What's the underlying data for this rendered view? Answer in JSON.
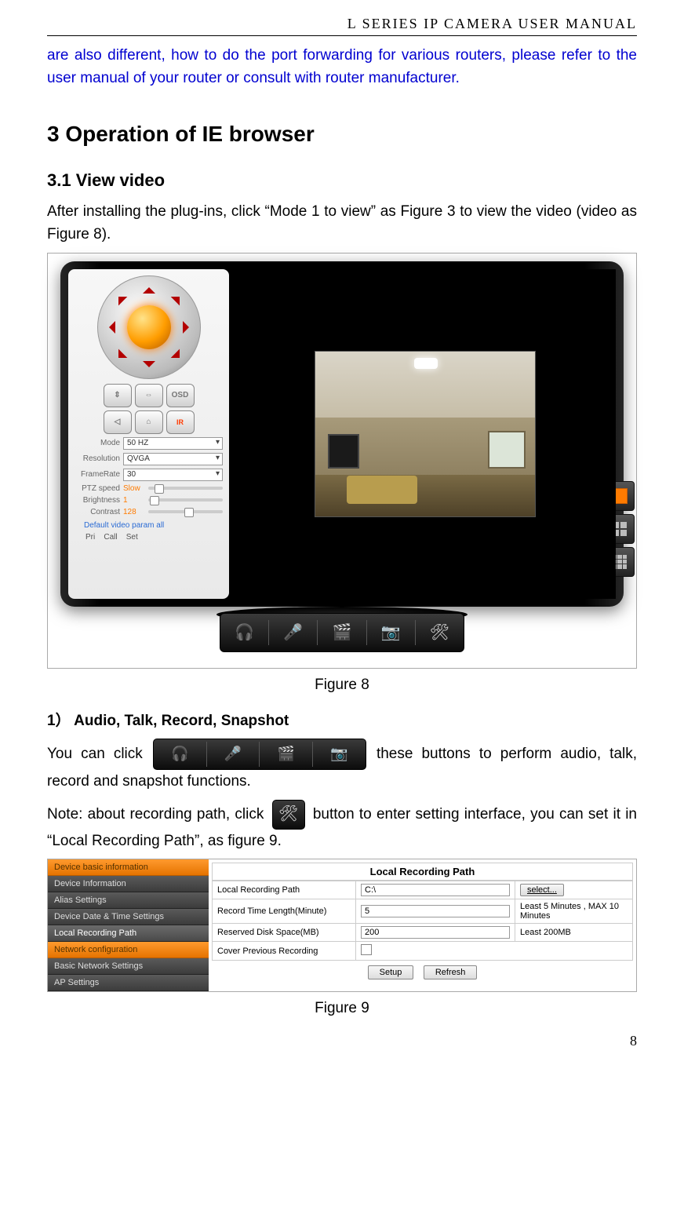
{
  "header": "L  SERIES  IP  CAMERA  USER  MANUAL",
  "intro_blue": "are also different, how to do the port forwarding for various routers, please refer to the user manual of your router or consult with router manufacturer.",
  "section3_title": "3   Operation of IE browser",
  "section31_title": "3.1 View video",
  "after_install_text": "After installing the plug-ins, click “Mode 1 to view” as Figure 3 to view the video (video as Figure 8).",
  "figure8_caption": "Figure 8",
  "sub1_title": "1） Audio, Talk, Record, Snapshot",
  "sub1_line1a": "You can click ",
  "sub1_line1b": "these buttons to perform audio, talk, record and snapshot functions.",
  "sub1_line2a": "Note: about recording path, click ",
  "sub1_line2b": " button to enter setting interface, you can set it in “Local Recording Path”, as figure 9.",
  "figure9_caption": "Figure 9",
  "page_number": "8",
  "f8": {
    "controls": {
      "mode_label": "Mode",
      "mode_value": "50 HZ",
      "res_label": "Resolution",
      "res_value": "QVGA",
      "fr_label": "FrameRate",
      "fr_value": "30",
      "ptz_label": "PTZ speed",
      "ptz_value": "Slow",
      "bri_label": "Brightness",
      "bri_value": "1",
      "con_label": "Contrast",
      "con_value": "128",
      "default_link": "Default video param all",
      "preset_pri": "Pri",
      "preset_call": "Call",
      "preset_set": "Set",
      "btn_osd": "OSD",
      "btn_ir": "IR"
    }
  },
  "f9": {
    "sidebar": {
      "head1": "Device basic information",
      "items1": [
        "Device Information",
        "Alias Settings",
        "Device Date & Time Settings",
        "Local Recording Path"
      ],
      "head2": "Network configuration",
      "items2": [
        "Basic Network Settings",
        "AP Settings"
      ]
    },
    "panel": {
      "title": "Local Recording Path",
      "rows": [
        {
          "label": "Local Recording Path",
          "value": "C:\\",
          "extra_type": "select",
          "extra": "select..."
        },
        {
          "label": "Record Time Length(Minute)",
          "value": "5",
          "extra_type": "hint",
          "extra": "Least 5 Minutes , MAX 10 Minutes"
        },
        {
          "label": "Reserved Disk Space(MB)",
          "value": "200",
          "extra_type": "hint",
          "extra": "Least 200MB"
        },
        {
          "label": "Cover Previous Recording",
          "value": "",
          "extra_type": "checkbox",
          "extra": ""
        }
      ],
      "btn_setup": "Setup",
      "btn_refresh": "Refresh"
    }
  }
}
